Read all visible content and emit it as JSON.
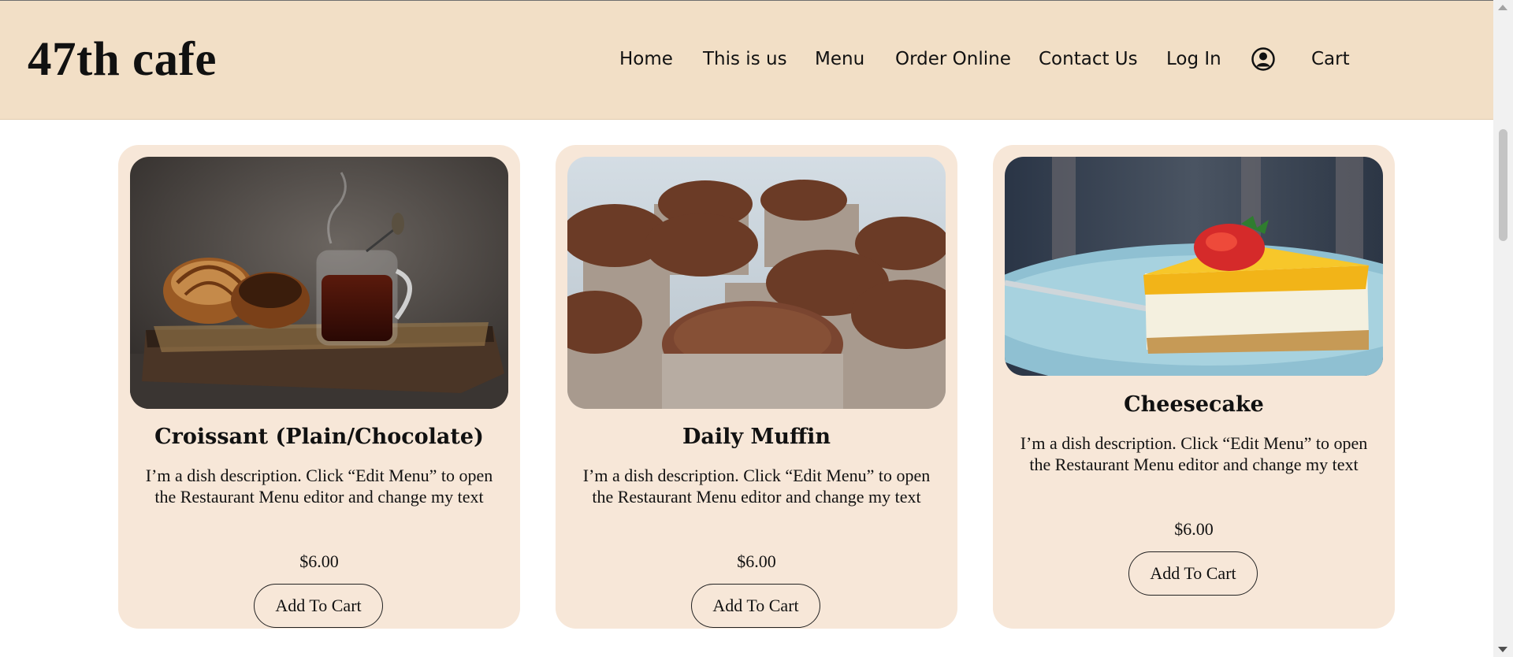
{
  "site": {
    "logo": "47th cafe"
  },
  "nav": {
    "items": [
      "Home",
      "This is us",
      "Menu",
      "Order Online",
      "Contact Us",
      "Log In"
    ],
    "account_icon": "account-circle-icon",
    "cart_label": "Cart"
  },
  "menu": {
    "cards": [
      {
        "name": "Croissant (Plain/Chocolate)",
        "description": "I’m a dish description. Click “Edit Menu” to open the Restaurant Menu editor and change my text",
        "price": "$6.00",
        "button": "Add To Cart",
        "image": "croissants-and-tea-photo"
      },
      {
        "name": "Daily Muffin",
        "description": "I’m a dish description. Click “Edit Menu” to open the Restaurant Menu editor and change my text",
        "price": "$6.00",
        "button": "Add To Cart",
        "image": "chocolate-muffins-photo"
      },
      {
        "name": "Cheesecake",
        "description": "I’m a dish description. Click “Edit Menu” to open the Restaurant Menu editor and change my text",
        "price": "$6.00",
        "button": "Add To Cart",
        "image": "cheesecake-with-strawberry-photo"
      }
    ]
  },
  "colors": {
    "header_bg": "#f2dfc6",
    "card_bg": "#f7e7d8",
    "text": "#111111"
  }
}
